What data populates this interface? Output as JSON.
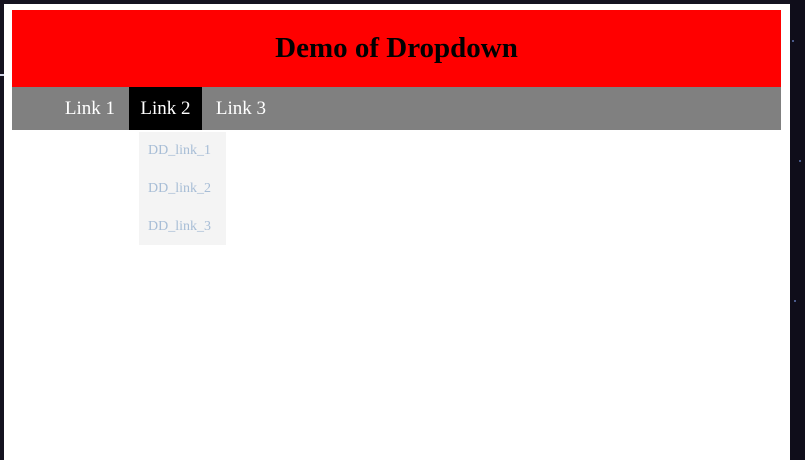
{
  "header": {
    "title": "Demo of Dropdown",
    "background_color": "#ff0000"
  },
  "navbar": {
    "background_color": "#808080",
    "active_color": "#000000",
    "links": [
      {
        "label": "Link 1",
        "active": false
      },
      {
        "label": "Link 2",
        "active": true
      },
      {
        "label": "Link 3",
        "active": false
      }
    ]
  },
  "dropdown": {
    "background_color": "#f4f4f4",
    "text_color": "#a7bdd6",
    "items": [
      {
        "label": "DD_link_1"
      },
      {
        "label": "DD_link_2"
      },
      {
        "label": "DD_link_3"
      }
    ]
  }
}
